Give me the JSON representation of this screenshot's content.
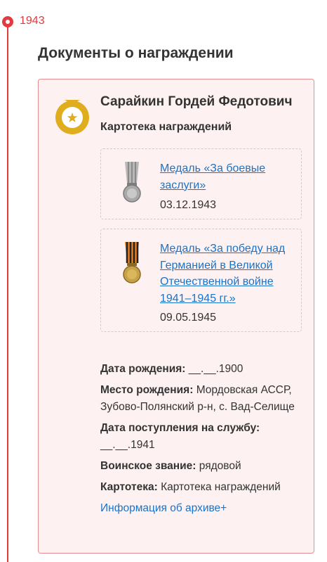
{
  "timeline": {
    "year": "1943"
  },
  "section": {
    "title": "Документы о награждении"
  },
  "card": {
    "name": "Сарайкин Гордей Федотович",
    "subtitle": "Картотека награждений",
    "awards": [
      {
        "title": "Медаль «За боевые заслуги»",
        "date": "03.12.1943",
        "icon": "medal-combat-merit-icon"
      },
      {
        "title": "Медаль «За победу над Германией в Великой Отечественной войне 1941–1945 гг.»",
        "date": "09.05.1945",
        "icon": "medal-victory-germany-icon"
      }
    ],
    "details": {
      "birth_date_label": "Дата рождения:",
      "birth_date_value": "__.__.1900",
      "birth_place_label": "Место рождения:",
      "birth_place_value": "Мордовская АССР, Зубово-Полянский р-н, с. Вад-Селище",
      "service_date_label": "Дата поступления на службу:",
      "service_date_value": "__.__.1941",
      "rank_label": "Воинское звание:",
      "rank_value": "рядовой",
      "archive_label": "Картотека:",
      "archive_value": "Картотека награждений"
    },
    "archive_link": "Информация об архиве+"
  },
  "colors": {
    "accent": "#e4393f",
    "link": "#1a73c8",
    "card_bg": "#fdf1f1",
    "card_border": "#e98c90",
    "badge": "#e0ad1e"
  }
}
